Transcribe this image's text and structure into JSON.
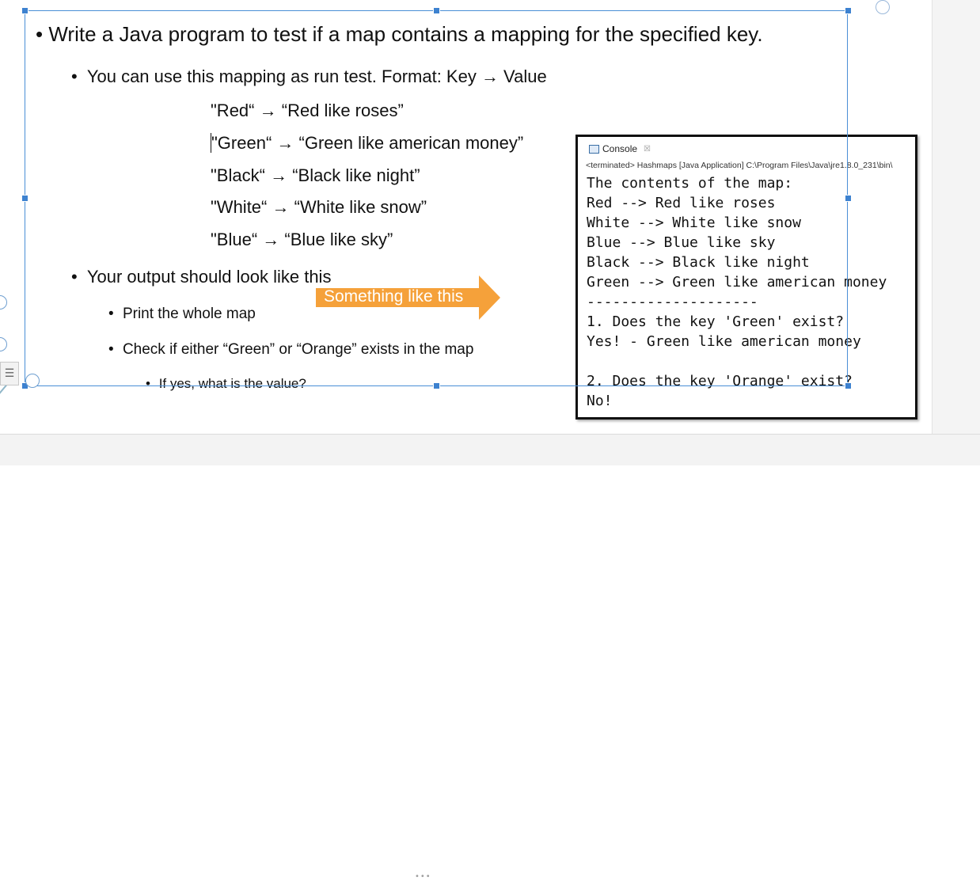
{
  "slide": {
    "heading": "Write a Java program to test if a map contains a mapping for the specified key.",
    "bullet_run_test": "You can use this mapping as run test. Format: Key → Value",
    "mappings": [
      {
        "key": "\"Red“",
        "value": "“Red like roses”"
      },
      {
        "key": "\"Green“",
        "value": "“Green like american money”"
      },
      {
        "key": "\"Black“",
        "value": "“Black like night”"
      },
      {
        "key": "\"White“",
        "value": "“White like snow”"
      },
      {
        "key": "\"Blue“",
        "value": "“Blue like sky”"
      }
    ],
    "arrow_glyph": "→",
    "bullet_output": "Your output should look like this",
    "sub_print": "Print the whole map",
    "sub_check": "Check if either “Green” or “Orange” exists in the map",
    "sub_sub_value": "If yes, what is the value?"
  },
  "callout": {
    "text": "Something like this",
    "color": "#f5a13a"
  },
  "console": {
    "tab_label": "Console",
    "close_glyph": "☒",
    "status": "<terminated> Hashmaps [Java Application] C:\\Program Files\\Java\\jre1.8.0_231\\bin\\",
    "output": "The contents of the map:\nRed --> Red like roses\nWhite --> White like snow\nBlue --> Blue like sky\nBlack --> Black like night\nGreen --> Green like american money\n--------------------\n1. Does the key 'Green' exist?\nYes! - Green like american money\n\n2. Does the key 'Orange' exist?\nNo!"
  },
  "ui": {
    "selection_color": "#4a8fd6",
    "layout_icon": "layout-options-icon",
    "resize_grip": "•••"
  }
}
